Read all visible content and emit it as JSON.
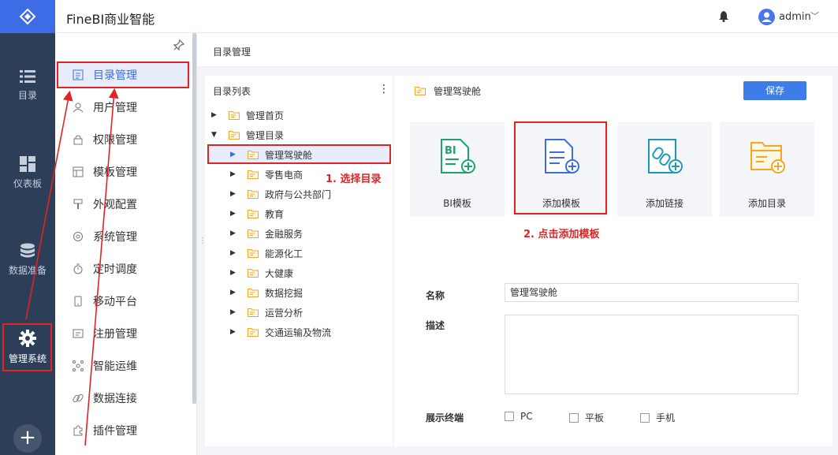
{
  "app": {
    "title": "FineBI商业智能",
    "user": "admin"
  },
  "rail": {
    "items": [
      {
        "label": "目录",
        "icon": "list-icon"
      },
      {
        "label": "仪表板",
        "icon": "dashboard-icon"
      },
      {
        "label": "数据准备",
        "icon": "database-icon"
      },
      {
        "label": "管理系统",
        "icon": "gear-icon",
        "active": true
      }
    ],
    "plus": "+"
  },
  "menu": {
    "items": [
      {
        "label": "目录管理",
        "icon": "catalog-icon",
        "active": true
      },
      {
        "label": "用户管理",
        "icon": "user-icon"
      },
      {
        "label": "权限管理",
        "icon": "lock-icon"
      },
      {
        "label": "模板管理",
        "icon": "template-icon"
      },
      {
        "label": "外观配置",
        "icon": "brush-icon"
      },
      {
        "label": "系统管理",
        "icon": "settings-icon"
      },
      {
        "label": "定时调度",
        "icon": "timer-icon"
      },
      {
        "label": "移动平台",
        "icon": "mobile-icon"
      },
      {
        "label": "注册管理",
        "icon": "register-icon"
      },
      {
        "label": "智能运维",
        "icon": "network-icon"
      },
      {
        "label": "数据连接",
        "icon": "link-icon"
      },
      {
        "label": "插件管理",
        "icon": "plugin-icon"
      }
    ]
  },
  "breadcrumb": "目录管理",
  "tree": {
    "header": "目录列表",
    "more": "⋮",
    "nodes": [
      {
        "label": "管理首页",
        "expanded": false
      },
      {
        "label": "管理目录",
        "expanded": true
      },
      {
        "label": "管理驾驶舱",
        "selected": true
      },
      {
        "label": "零售电商"
      },
      {
        "label": "政府与公共部门"
      },
      {
        "label": "教育"
      },
      {
        "label": "金融服务"
      },
      {
        "label": "能源化工"
      },
      {
        "label": "大健康"
      },
      {
        "label": "数据挖掘"
      },
      {
        "label": "运营分析"
      },
      {
        "label": "交通运输及物流"
      }
    ]
  },
  "panel": {
    "title": "管理驾驶舱",
    "save": "保存",
    "cards": [
      {
        "label": "BI模板",
        "icon": "bi-template-icon"
      },
      {
        "label": "添加模板",
        "icon": "add-template-icon"
      },
      {
        "label": "添加链接",
        "icon": "add-link-icon"
      },
      {
        "label": "添加目录",
        "icon": "add-folder-icon"
      }
    ],
    "form": {
      "name_label": "名称",
      "name_value": "管理驾驶舱",
      "desc_label": "描述",
      "terminal_label": "展示终端",
      "terminals": [
        "PC",
        "平板",
        "手机"
      ]
    }
  },
  "annotations": {
    "step1": "1. 选择目录",
    "step2": "2. 点击添加模板"
  },
  "colors": {
    "accent": "#3e6be6",
    "rail": "#2c3e58",
    "annotation": "#e02424",
    "folder": "#f5a623",
    "bi_green": "#1aa56d",
    "teal": "#1a9ab8"
  }
}
